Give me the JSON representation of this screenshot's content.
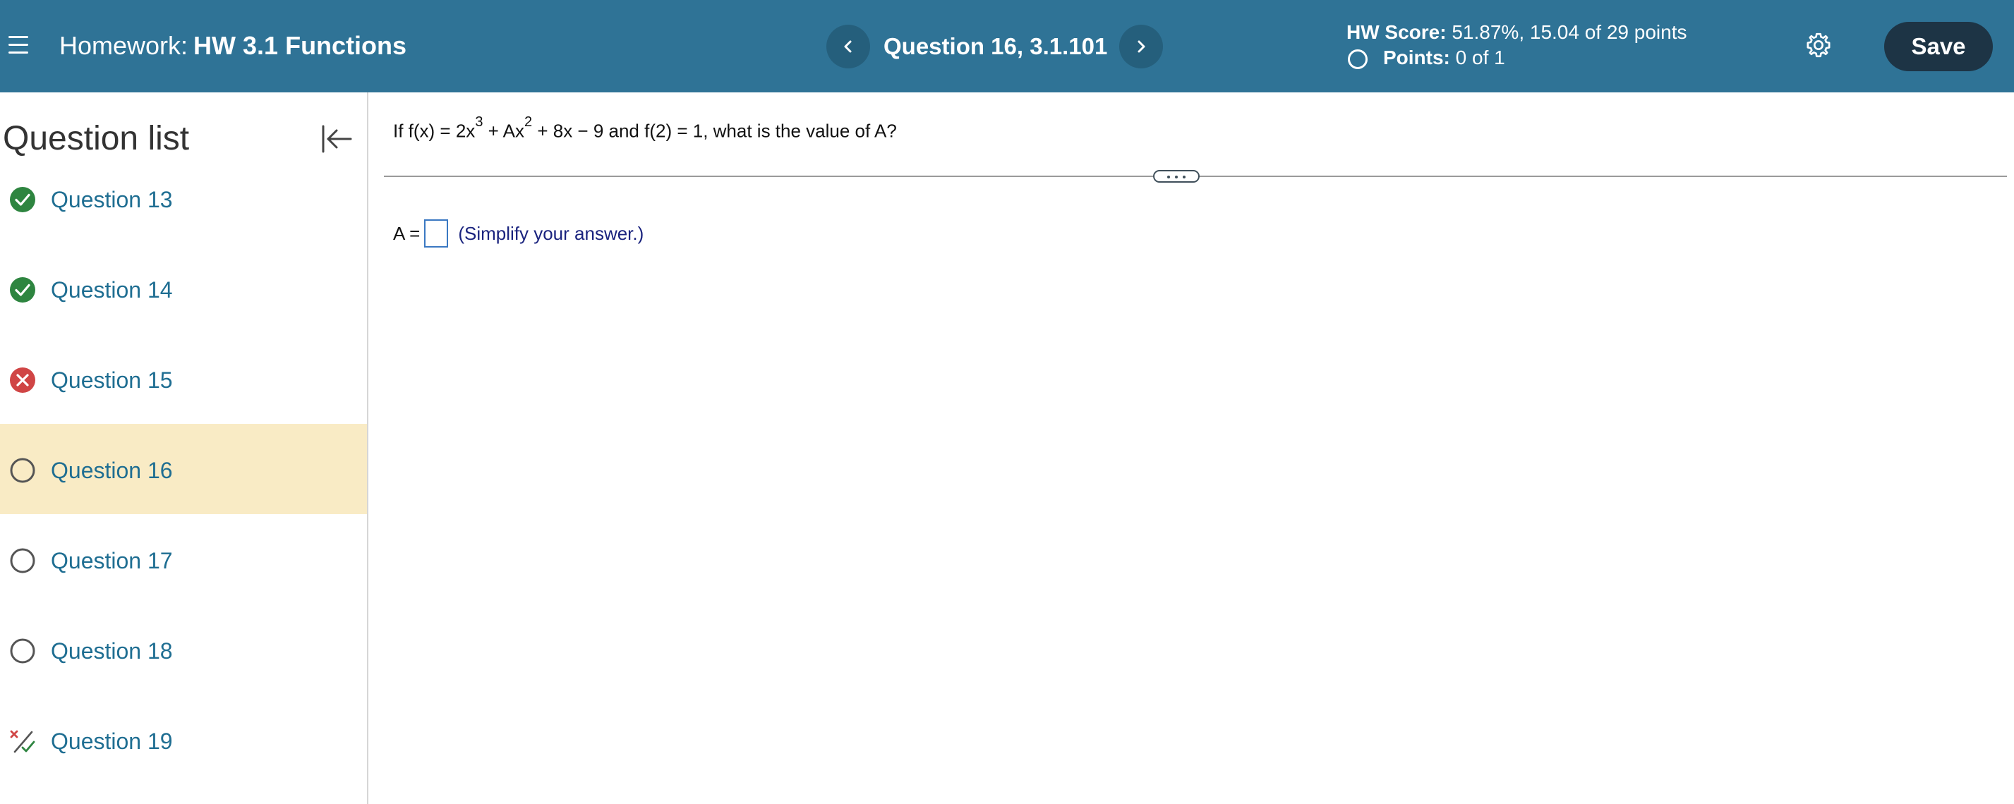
{
  "header": {
    "homework_prefix": "Homework:",
    "homework_name": "HW 3.1 Functions",
    "question_title": "Question 16, 3.1.101",
    "hw_score_label": "HW Score:",
    "hw_score_value": "51.87%, 15.04 of 29 points",
    "points_label": "Points:",
    "points_value": "0 of 1",
    "save_label": "Save",
    "icons": [
      "menu-icon",
      "chevron-left-icon",
      "chevron-right-icon",
      "gear-icon"
    ],
    "colors": {
      "header_bg": "#2f7396",
      "save_bg": "#1d3445"
    }
  },
  "sidebar": {
    "title": "Question list",
    "items": [
      {
        "label": "Question 13",
        "status": "correct"
      },
      {
        "label": "Question 14",
        "status": "correct"
      },
      {
        "label": "Question 15",
        "status": "incorrect"
      },
      {
        "label": "Question 16",
        "status": "unanswered",
        "active": true
      },
      {
        "label": "Question 17",
        "status": "unanswered"
      },
      {
        "label": "Question 18",
        "status": "unanswered"
      },
      {
        "label": "Question 19",
        "status": "partial"
      }
    ],
    "colors": {
      "active_bg": "#f9ebc5",
      "correct": "#2e8540",
      "incorrect": "#d04545",
      "link": "#1f6e92"
    }
  },
  "question": {
    "prompt_part1": "If f(x) = 2x",
    "exp1": "3",
    "prompt_part2": " + Ax",
    "exp2": "2",
    "prompt_part3": " + 8x − 9 and f(2) = 1, what is the value of A?",
    "answer_label": "A =",
    "answer_value": "",
    "answer_hint": "(Simplify your answer.)"
  }
}
